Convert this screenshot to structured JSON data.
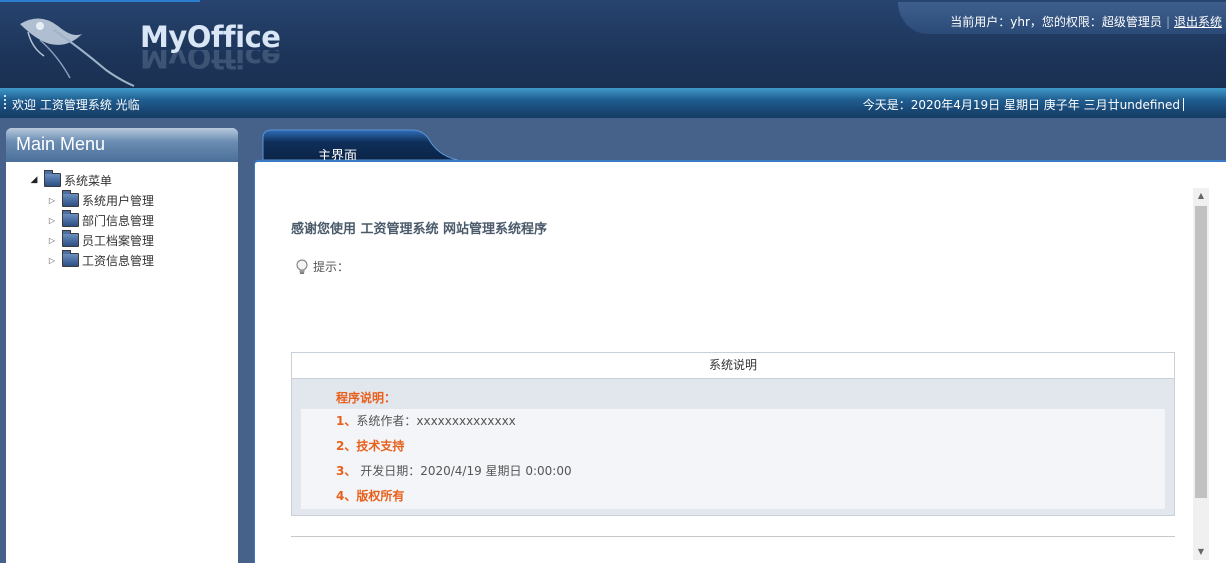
{
  "header": {
    "brand": "MyOffice",
    "user_info": "当前用户：yhr，您的权限：超级管理员",
    "logout_label": "退出系统"
  },
  "welcome_bar": {
    "welcome": "欢迎 工资管理系统 光临",
    "today": "今天是：2020年4月19日 星期日 庚子年 三月廿undefined"
  },
  "sidebar": {
    "title": "Main Menu",
    "root": {
      "label": "系统菜单"
    },
    "items": [
      {
        "label": "系统用户管理"
      },
      {
        "label": "部门信息管理"
      },
      {
        "label": "员工档案管理"
      },
      {
        "label": "工资信息管理"
      }
    ]
  },
  "main": {
    "tab_label": "主界面",
    "thanks": "感谢您使用 工资管理系统 网站管理系统程序",
    "tip": "提示：",
    "info_box": {
      "heading": "系统说明",
      "title": "程序说明：",
      "items": [
        {
          "num": "1、",
          "text": "系统作者：xxxxxxxxxxxxxx"
        },
        {
          "num": "",
          "text": "2、技术支持"
        },
        {
          "num": "3、",
          "text": "开发日期：2020/4/19 星期日 0:00:00"
        },
        {
          "num": "",
          "text": "4、版权所有"
        }
      ]
    }
  },
  "colors": {
    "header_bg": "#1d355a",
    "welcome_bg": "#1f5d90",
    "accent_orange": "#e8601c",
    "tab_blue": "#3b7ac4"
  }
}
